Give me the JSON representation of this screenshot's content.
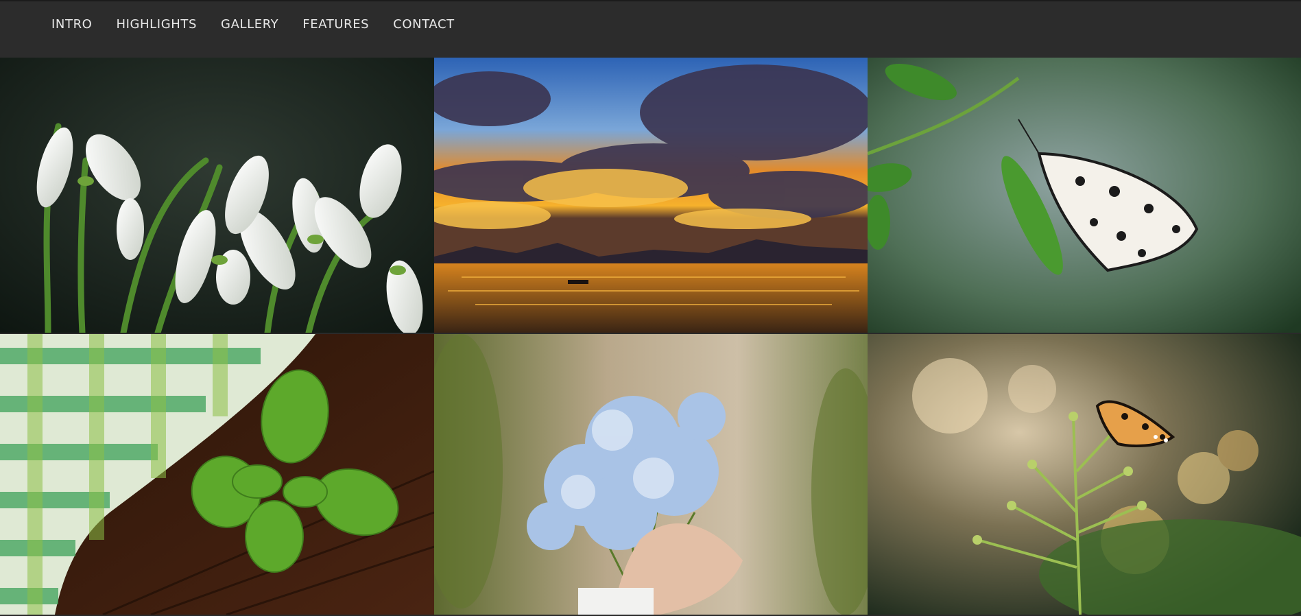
{
  "nav": {
    "items": [
      {
        "label": "INTRO"
      },
      {
        "label": "HIGHLIGHTS"
      },
      {
        "label": "GALLERY"
      },
      {
        "label": "FEATURES"
      },
      {
        "label": "CONTACT"
      }
    ]
  },
  "gallery": {
    "tiles": [
      {
        "subject": "snowdrop-flowers"
      },
      {
        "subject": "sunset-over-lake"
      },
      {
        "subject": "white-butterfly-on-leaf"
      },
      {
        "subject": "basil-on-wooden-table"
      },
      {
        "subject": "forget-me-not-bouquet"
      },
      {
        "subject": "orange-butterfly-on-plant"
      }
    ]
  }
}
